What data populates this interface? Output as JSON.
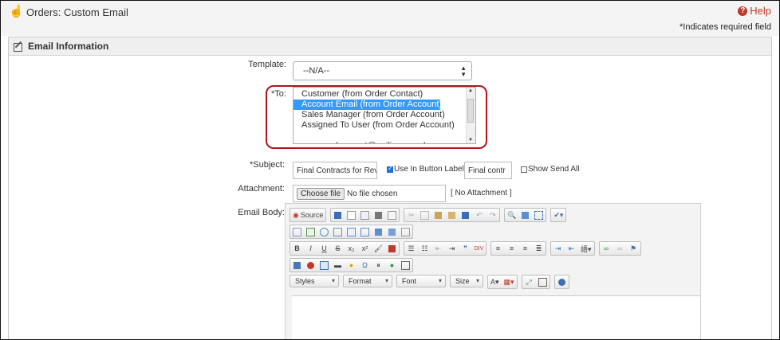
{
  "header": {
    "title": "Orders: Custom Email",
    "help_label": "Help",
    "required_note": "*Indicates required field"
  },
  "panel": {
    "title": "Email Information"
  },
  "form": {
    "template_label": "Template:",
    "template_value": "--N/A--",
    "to_label": "*To:",
    "to_options": [
      "Customer (from Order Contact)",
      "Account Email (from Order Account)",
      "Sales Manager (from Order Account)",
      "Assigned To User (from Order Account)",
      "",
      "nesuser (support@agiliron.com)"
    ],
    "to_selected_index": 1,
    "subject_label": "*Subject:",
    "subject_value": "Final Contracts for Revi",
    "use_button_label": "Use In Button Label:",
    "button_label_value": "Final contr",
    "show_send_all": "Show Send All",
    "attachment_label": "Attachment:",
    "choose_file": "Choose file",
    "no_file": "No file chosen",
    "no_attachment": "[ No Attachment ]",
    "email_body_label": "Email Body:"
  },
  "editor": {
    "source_label": "Source",
    "styles": "Styles",
    "format": "Format",
    "font": "Font",
    "size": "Size"
  },
  "colors": {
    "accent": "#c0392b",
    "highlight_border": "#b3141e",
    "selection": "#3399ff"
  }
}
